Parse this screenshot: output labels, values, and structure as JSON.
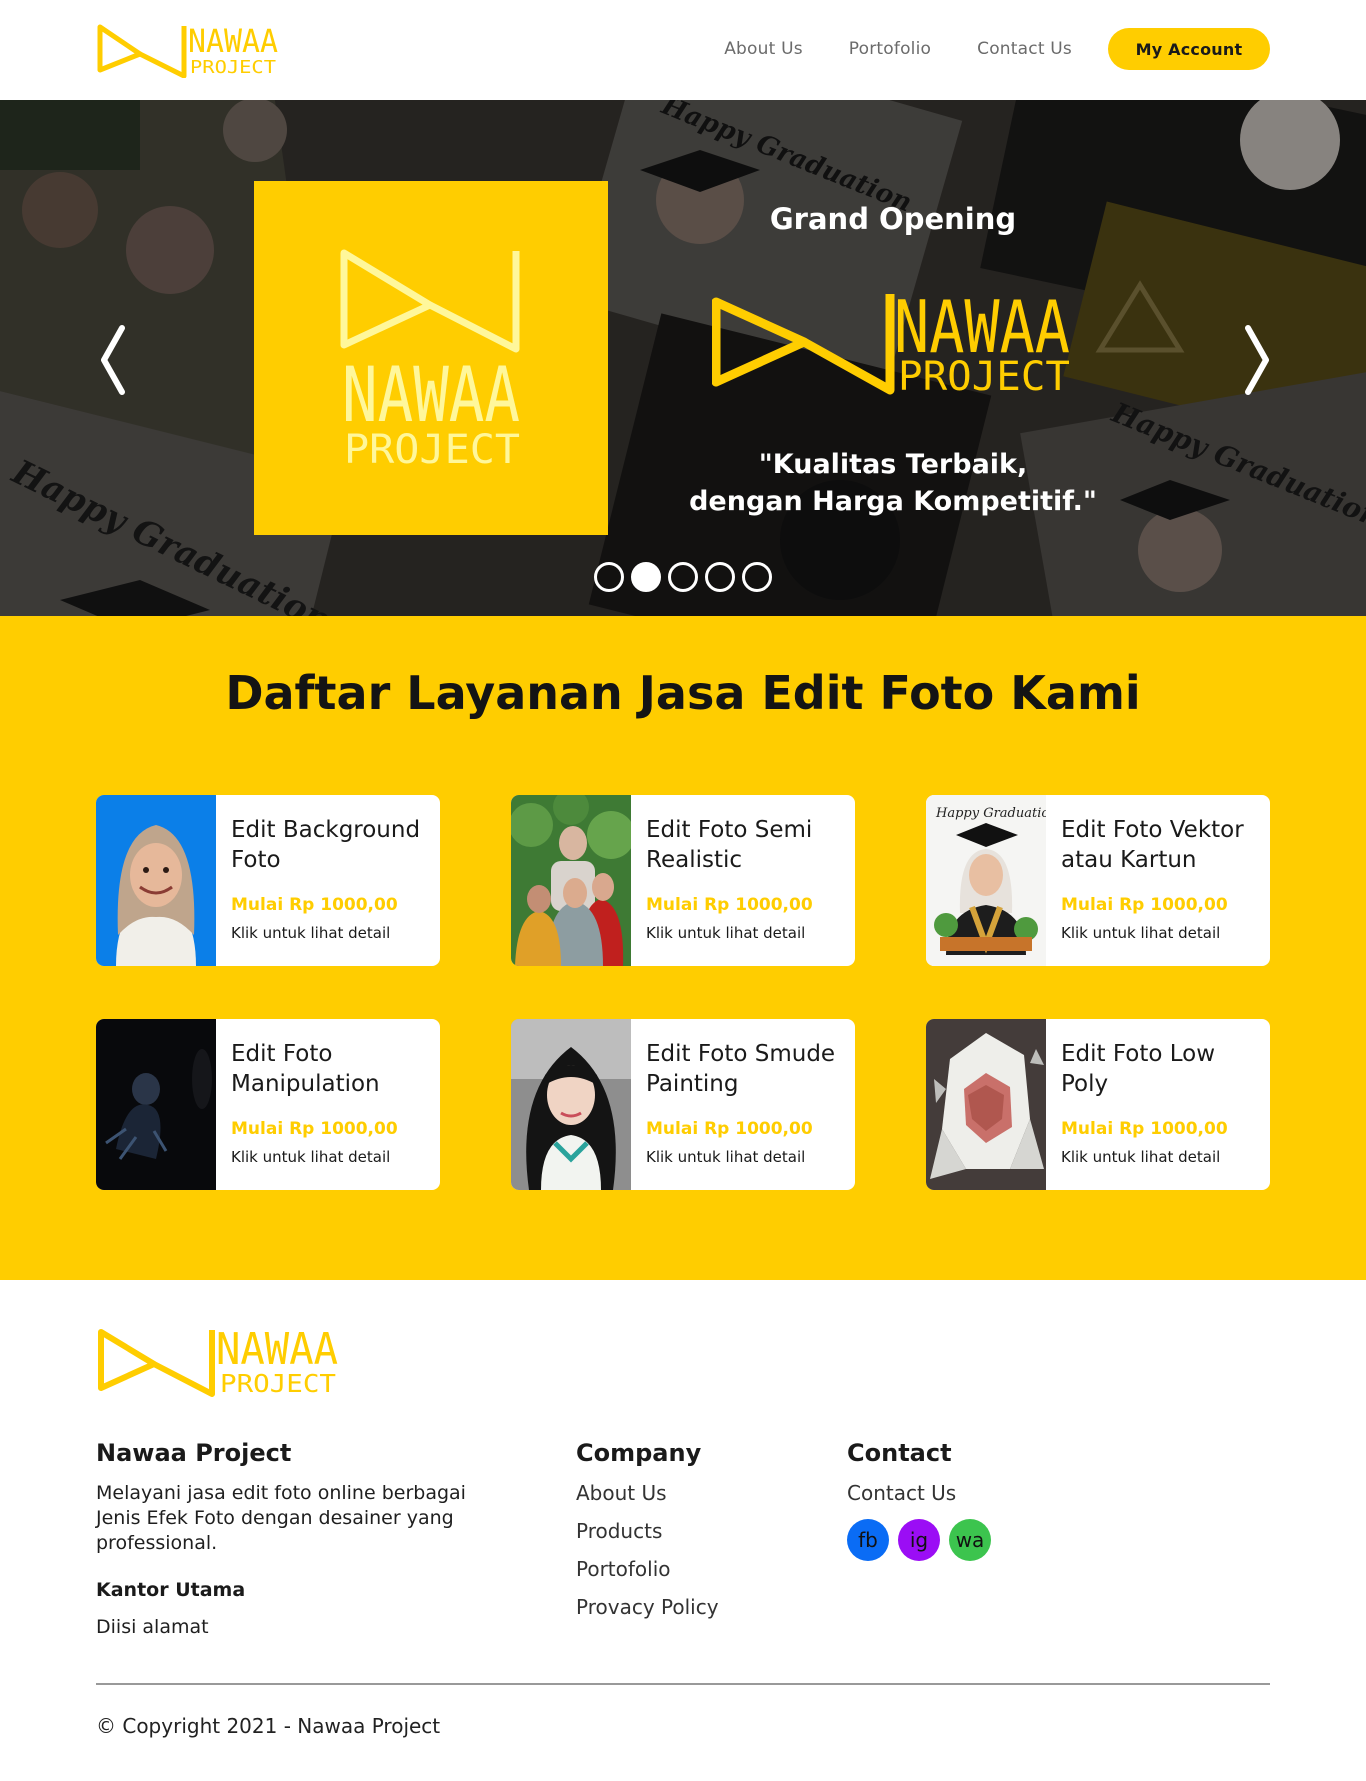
{
  "brand": {
    "name_line1": "NAWAA",
    "name_line2": "PROJECT",
    "accent_color": "#ffcd00"
  },
  "nav": {
    "items": [
      {
        "label": "About Us"
      },
      {
        "label": "Portofolio"
      },
      {
        "label": "Contact Us"
      }
    ],
    "account_label": "My Account"
  },
  "hero": {
    "headline": "Grand Opening",
    "tagline_line1": "\"Kualitas Terbaik,",
    "tagline_line2": "dengan Harga Kompetitif.\"",
    "bg_text_1": "Happy Graduation",
    "bg_text_2": "Happy Graduation",
    "bg_text_3": "Happy Graduation",
    "prev_icon": "chevron-left-icon",
    "next_icon": "chevron-right-icon",
    "slide_count": 5,
    "active_slide": 2
  },
  "services": {
    "title": "Daftar Layanan Jasa Edit Foto Kami",
    "items": [
      {
        "title": "Edit Background Foto",
        "price": "Mulai Rp 1000,00",
        "detail": "Klik untuk lihat detail"
      },
      {
        "title": "Edit Foto Semi Realistic",
        "price": "Mulai Rp 1000,00",
        "detail": "Klik untuk lihat detail"
      },
      {
        "title": "Edit Foto Vektor atau Kartun",
        "price": "Mulai Rp 1000,00",
        "detail": "Klik untuk lihat detail",
        "thumb_caption": "Happy Graduation"
      },
      {
        "title": "Edit Foto Manipulation",
        "price": "Mulai Rp 1000,00",
        "detail": "Klik untuk lihat detail"
      },
      {
        "title": "Edit Foto Smude Painting",
        "price": "Mulai Rp 1000,00",
        "detail": "Klik untuk lihat detail"
      },
      {
        "title": "Edit Foto Low Poly",
        "price": "Mulai Rp 1000,00",
        "detail": "Klik untuk lihat detail"
      }
    ]
  },
  "footer": {
    "about": {
      "title": "Nawaa Project",
      "description": "Melayani jasa edit foto online berbagai Jenis Efek Foto dengan desainer yang professional.",
      "office_label": "Kantor Utama",
      "address": "Diisi alamat"
    },
    "company": {
      "title": "Company",
      "links": [
        {
          "label": "About Us"
        },
        {
          "label": "Products"
        },
        {
          "label": "Portofolio"
        },
        {
          "label": "Provacy Policy"
        }
      ]
    },
    "contact": {
      "title": "Contact",
      "link": "Contact Us",
      "socials": [
        {
          "label": "fb",
          "color": "#0a6cf5"
        },
        {
          "label": "ig",
          "color": "#9b0df5"
        },
        {
          "label": "wa",
          "color": "#3cc44e"
        }
      ]
    },
    "copyright": "© Copyright 2021 - Nawaa Project"
  }
}
